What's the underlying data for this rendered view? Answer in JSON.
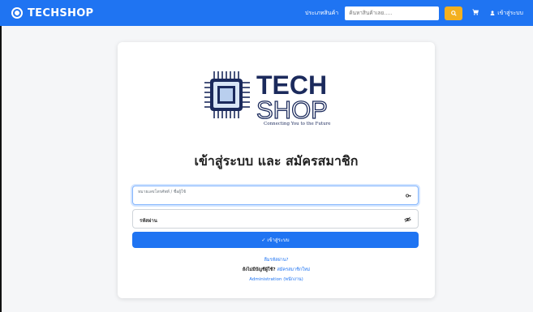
{
  "navbar": {
    "brand": "TECHSHOP",
    "category_label": "ประเภทสินค้า",
    "search_placeholder": "ค้นหาสินค้าเลย.....",
    "login_label": "เข้าสู่ระบบ"
  },
  "logo": {
    "word_top": "TECH",
    "word_bottom": "SHOP",
    "tagline": "Connecting You to the Future"
  },
  "card": {
    "heading": "เข้าสู่ระบบ และ สมัครสมาชิก",
    "field_user_label": "หมายเลขโทรศัพท์ / ชื่อผู้ใช้",
    "field_password_label": "รหัสผ่าน",
    "submit_label": "✓ เข้าสู่ระบบ",
    "forgot_label": "ลืมรหัสผ่าน?",
    "no_account_label": "ยังไม่มีบัญชีผู้ใช้? ",
    "register_label": "สมัครสมาชิกใหม่",
    "admin_label": "Administration (พนักงาน)"
  },
  "colors": {
    "primary": "#1f74f2",
    "warning": "#f3b01f",
    "logo_navy": "#1b2a5c"
  },
  "icons": [
    "brand-chip-icon",
    "search-icon",
    "cart-icon",
    "user-icon",
    "key-icon",
    "eye-slash-icon"
  ]
}
